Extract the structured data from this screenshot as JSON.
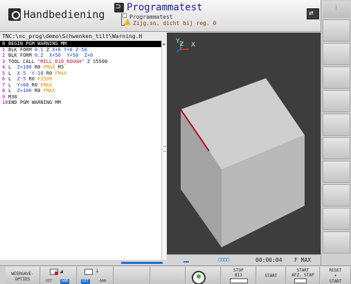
{
  "header": {
    "mode_left": "Handbediening",
    "mode_right": "Programmatest",
    "subline1": "Programmatest",
    "subline2": "Zijg.sn. dicht bij reg. 0"
  },
  "program": {
    "path": "TNC:\\nc_prog\\demo\\Schwenken_tilt\\Warning.H",
    "lines": [
      {
        "n": "0",
        "t": "BEGIN PGM WARNING MM",
        "sel": true
      },
      {
        "n": "1",
        "t": "BLK FORM 0.1 Z X+0 Y+0 Z-50"
      },
      {
        "n": "2",
        "t": "BLK FORM 0.2  X+50  Y+50  Z+0"
      },
      {
        "n": "3",
        "t": "TOOL CALL \"MILL_D10_ROUGH\" Z S5500"
      },
      {
        "n": "4",
        "t": "L  Z+100 R0 FMAX M3"
      },
      {
        "n": "5",
        "t": "L  X-5  Y-10 R0 FMAX"
      },
      {
        "n": "6",
        "t": "L  Z-5 R0 F2500"
      },
      {
        "n": "7",
        "t": "L  Y+60 R0 FMAX"
      },
      {
        "n": "8",
        "t": "L  Z+100 R0 FMAX"
      },
      {
        "n": "9",
        "t": "M30"
      },
      {
        "n": "10",
        "t": "END PGM WARNING MM"
      }
    ]
  },
  "graphic": {
    "axis_y": "Y",
    "axis_z": "Z",
    "axis_x": "X",
    "cube_top": "#cfcfcf",
    "cube_left": "#a3a3a3",
    "cube_right": "#b9b9b9",
    "edge_color": "#b01020"
  },
  "status": {
    "time": "00:00:04",
    "feed": "F MAX",
    "progress_dots": "○○○○"
  },
  "softkeys": {
    "weergave_line1": "WEERGAVE-",
    "weergave_line2": "OPTIES",
    "uit1": "UIT",
    "aan1": "AAN",
    "uit2": "UIT",
    "aan2": "AAN",
    "stop_line1": "STOP",
    "stop_line2": "BIJ",
    "start": "START",
    "start_afz_line1": "START",
    "start_afz_line2": "AFZ. STAP",
    "reset_line1": "RESET",
    "reset_line2": "+",
    "reset_line3": "START"
  }
}
